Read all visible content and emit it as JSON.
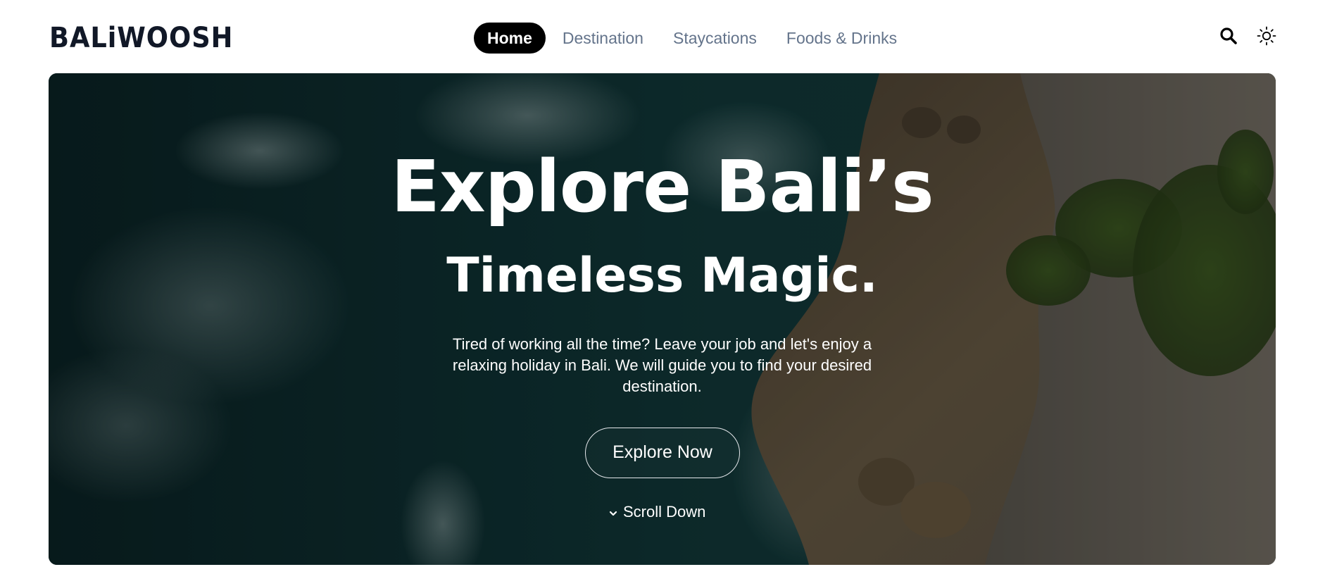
{
  "brand": {
    "logo_text": "BALiWOOSH"
  },
  "nav": {
    "items": [
      {
        "label": "Home",
        "active": true
      },
      {
        "label": "Destination",
        "active": false
      },
      {
        "label": "Staycations",
        "active": false
      },
      {
        "label": "Foods & Drinks",
        "active": false
      }
    ]
  },
  "header_icons": {
    "search": "search-icon",
    "theme": "sun-icon"
  },
  "hero": {
    "title_line1": "Explore Bali’s",
    "title_line2": "Timeless Magic.",
    "description": "Tired of working all the time? Leave your job and let's enjoy a relaxing holiday in Bali. We will guide you to find your desired destination.",
    "cta_label": "Explore Now",
    "scroll_label": "Scroll Down"
  },
  "colors": {
    "nav_active_bg": "#000000",
    "nav_text": "#64748b",
    "logo": "#111827",
    "hero_text": "#ffffff"
  }
}
